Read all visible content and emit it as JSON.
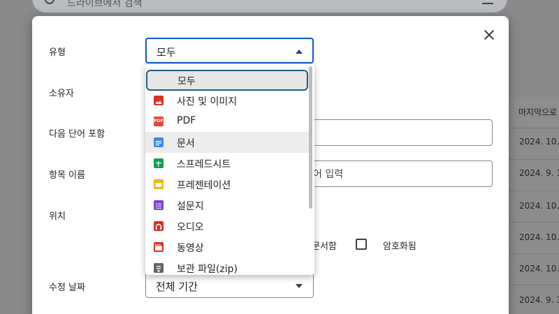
{
  "background": {
    "search_placeholder": "드라이브에서 검색",
    "column_header": "마지막으로",
    "dates": [
      "2024. 10.",
      "2024. 9. 1",
      "2024. 10.",
      "2024. 10.",
      "2024. 10.",
      "2024. 9. 3"
    ]
  },
  "form": {
    "type_label": "유형",
    "type_value": "모두",
    "owner_label": "소유자",
    "includes_words_label": "다음 단어 포함",
    "item_name_label": "항목 이름",
    "item_name_placeholder_visible": "어 입력",
    "location_label": "위치",
    "checkbox_partial_label": "문서함",
    "encrypted_label": "암호화됨",
    "modified_date_label": "수정 날짜",
    "modified_date_value": "전체 기간"
  },
  "dropdown": {
    "items": [
      {
        "label": "모두",
        "icon": "none",
        "state": "selected"
      },
      {
        "label": "사진 및 이미지",
        "icon": "image-icon",
        "color": "#d93025"
      },
      {
        "label": "PDF",
        "icon": "pdf-icon",
        "color": "#ea4335",
        "icon_text": "PDF"
      },
      {
        "label": "문서",
        "icon": "docs-icon",
        "color": "#4285f4",
        "state": "hover"
      },
      {
        "label": "스프레드시트",
        "icon": "sheets-icon",
        "color": "#0f9d58"
      },
      {
        "label": "프레젠테이션",
        "icon": "slides-icon",
        "color": "#f4b400"
      },
      {
        "label": "설문지",
        "icon": "forms-icon",
        "color": "#7e3fcf"
      },
      {
        "label": "오디오",
        "icon": "audio-icon",
        "color": "#d93025"
      },
      {
        "label": "동영상",
        "icon": "video-icon",
        "color": "#d93025"
      },
      {
        "label": "보관 파일(zip)",
        "icon": "archive-icon",
        "color": "#5f6368"
      }
    ]
  }
}
